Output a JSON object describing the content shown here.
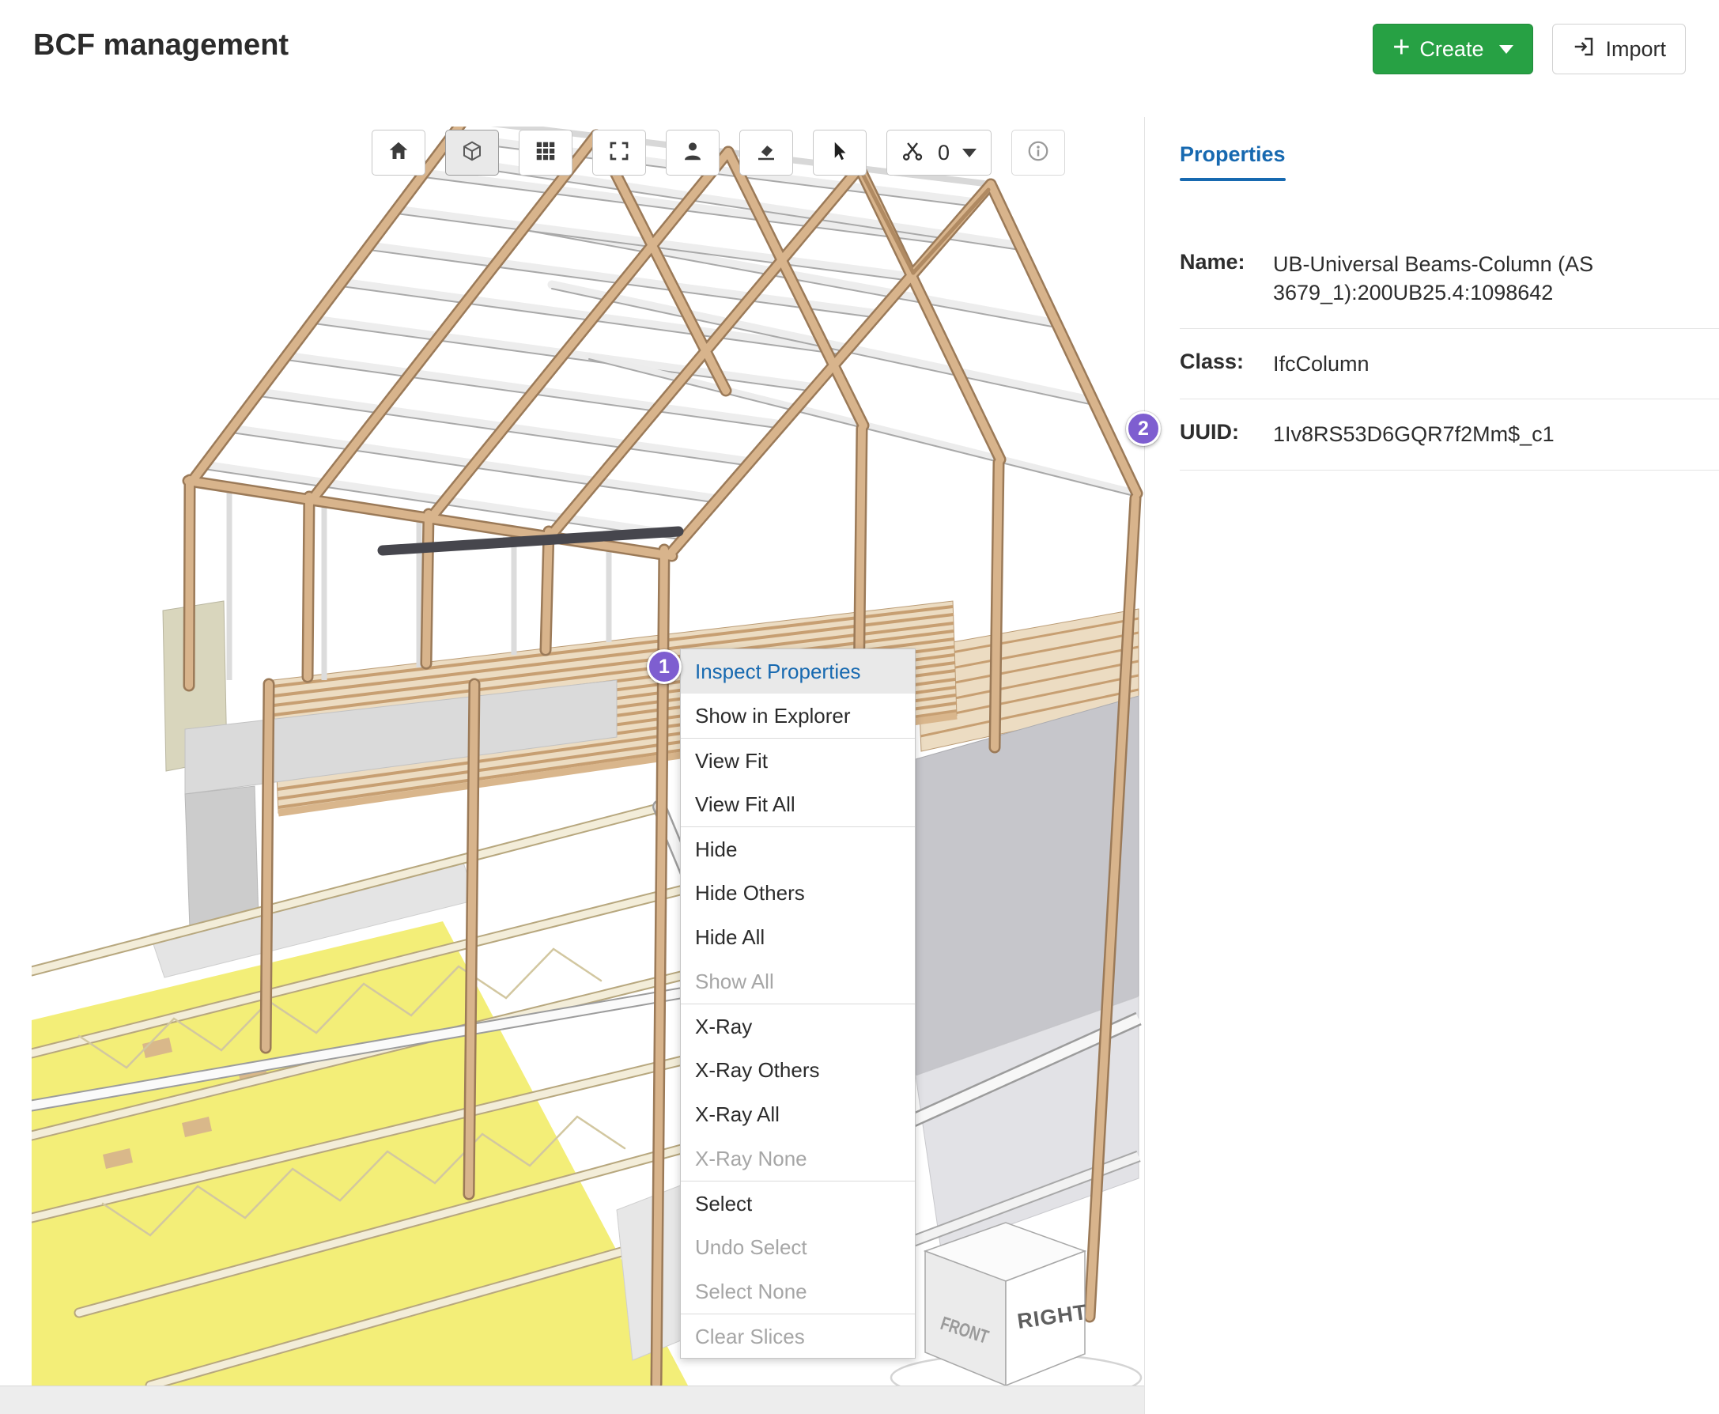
{
  "header": {
    "title": "BCF management",
    "create_button": {
      "label": "Create",
      "icon": "plus-icon",
      "plus_glyph": "+"
    },
    "import_button": {
      "label": "Import",
      "icon": "import-icon"
    }
  },
  "viewer": {
    "toolbar": {
      "buttons": [
        {
          "icon": "home-icon"
        },
        {
          "icon": "cube-icon",
          "active": true
        },
        {
          "icon": "grid-icon"
        },
        {
          "icon": "fullscreen-icon"
        },
        {
          "icon": "person-icon"
        },
        {
          "icon": "eraser-icon"
        },
        {
          "icon": "cursor-icon"
        },
        {
          "icon": "scissors-icon",
          "count": "0",
          "has_dropdown": true
        },
        {
          "icon": "info-icon"
        }
      ],
      "slice_count": "0"
    },
    "nav_cube": {
      "right_face": "RIGHT",
      "front_face": "FRONT"
    }
  },
  "annotations": {
    "step1": "1",
    "step2": "2"
  },
  "context_menu": {
    "items": [
      {
        "label": "Inspect Properties",
        "highlighted": true
      },
      {
        "label": "Show in Explorer"
      },
      {
        "label": "View Fit"
      },
      {
        "label": "View Fit All"
      },
      {
        "label": "Hide"
      },
      {
        "label": "Hide Others"
      },
      {
        "label": "Hide All"
      },
      {
        "label": "Show All",
        "disabled": true
      },
      {
        "label": "X-Ray"
      },
      {
        "label": "X-Ray Others"
      },
      {
        "label": "X-Ray All"
      },
      {
        "label": "X-Ray None",
        "disabled": true
      },
      {
        "label": "Select"
      },
      {
        "label": "Undo Select",
        "disabled": true
      },
      {
        "label": "Select None",
        "disabled": true
      },
      {
        "label": "Clear Slices",
        "disabled": true
      }
    ]
  },
  "properties_panel": {
    "tab_label": "Properties",
    "fields": [
      {
        "label": "Name:",
        "value": "UB-Universal Beams-Column (AS 3679_1):200UB25.4:1098642"
      },
      {
        "label": "Class:",
        "value": "IfcColumn"
      },
      {
        "label": "UUID:",
        "value": "1Iv8RS53D6GQR7f2Mm$_c1"
      }
    ]
  },
  "colors": {
    "accent_blue": "#1769b0",
    "create_green": "#27a144",
    "badge_purple": "#7e5ed0",
    "menu_highlight_bg": "#e9e9e9"
  }
}
